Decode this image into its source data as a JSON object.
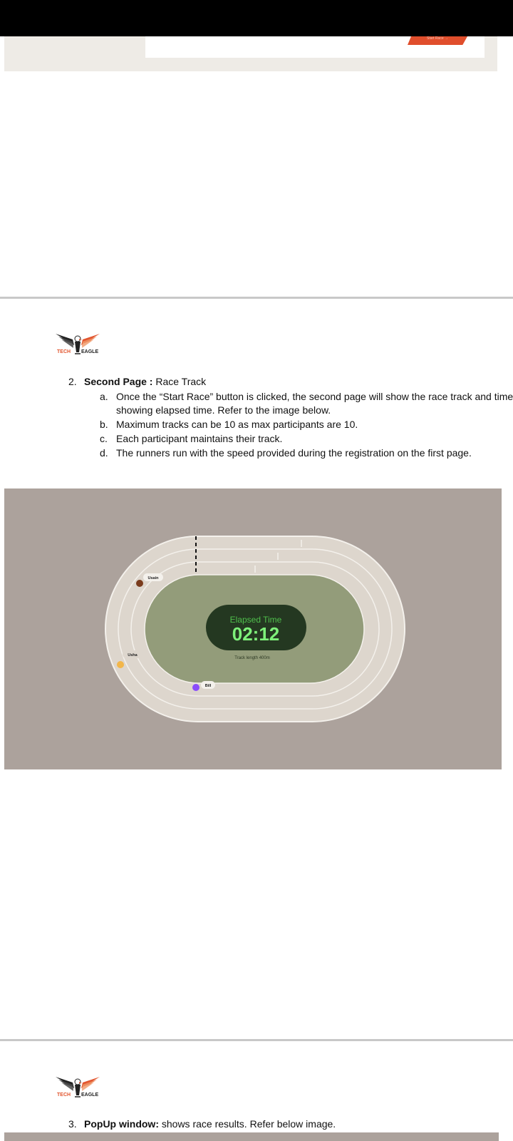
{
  "prev_page": {
    "start_button_label": "Start Race  →"
  },
  "logo": {
    "tech": "TECH",
    "eagle": "EAGLE"
  },
  "section2": {
    "number": "2.",
    "heading": "Second Page :",
    "title": "Race Track",
    "items": [
      {
        "letter": "a.",
        "text": "Once the “Start Race” button is clicked, the second page will show the race track and timer showing elapsed time. Refer to the image below."
      },
      {
        "letter": "b.",
        "text": "Maximum tracks can be 10 as max participants are 10."
      },
      {
        "letter": "c.",
        "text": "Each participant maintains their track."
      },
      {
        "letter": "d.",
        "text": "The runners run with the speed provided during the registration on the first page."
      }
    ]
  },
  "race": {
    "elapsed_label": "Elapsed Time",
    "elapsed_value": "02:12",
    "track_length": "Track length 400m",
    "runners": [
      {
        "name": "Usain",
        "color": "#7a3b1c"
      },
      {
        "name": "Usha",
        "color": "#f2b64a"
      },
      {
        "name": "Bill",
        "color": "#8a4dfb"
      }
    ],
    "colors": {
      "background": "#aca29c",
      "track": "#ddd6cd",
      "infield": "#939c7a",
      "timer_bg": "#243821",
      "timer_label": "#4fbf4c",
      "timer_value": "#7ef07a"
    }
  },
  "section3": {
    "number": "3.",
    "heading": "PopUp window:",
    "text": "shows race results. Refer below image."
  }
}
